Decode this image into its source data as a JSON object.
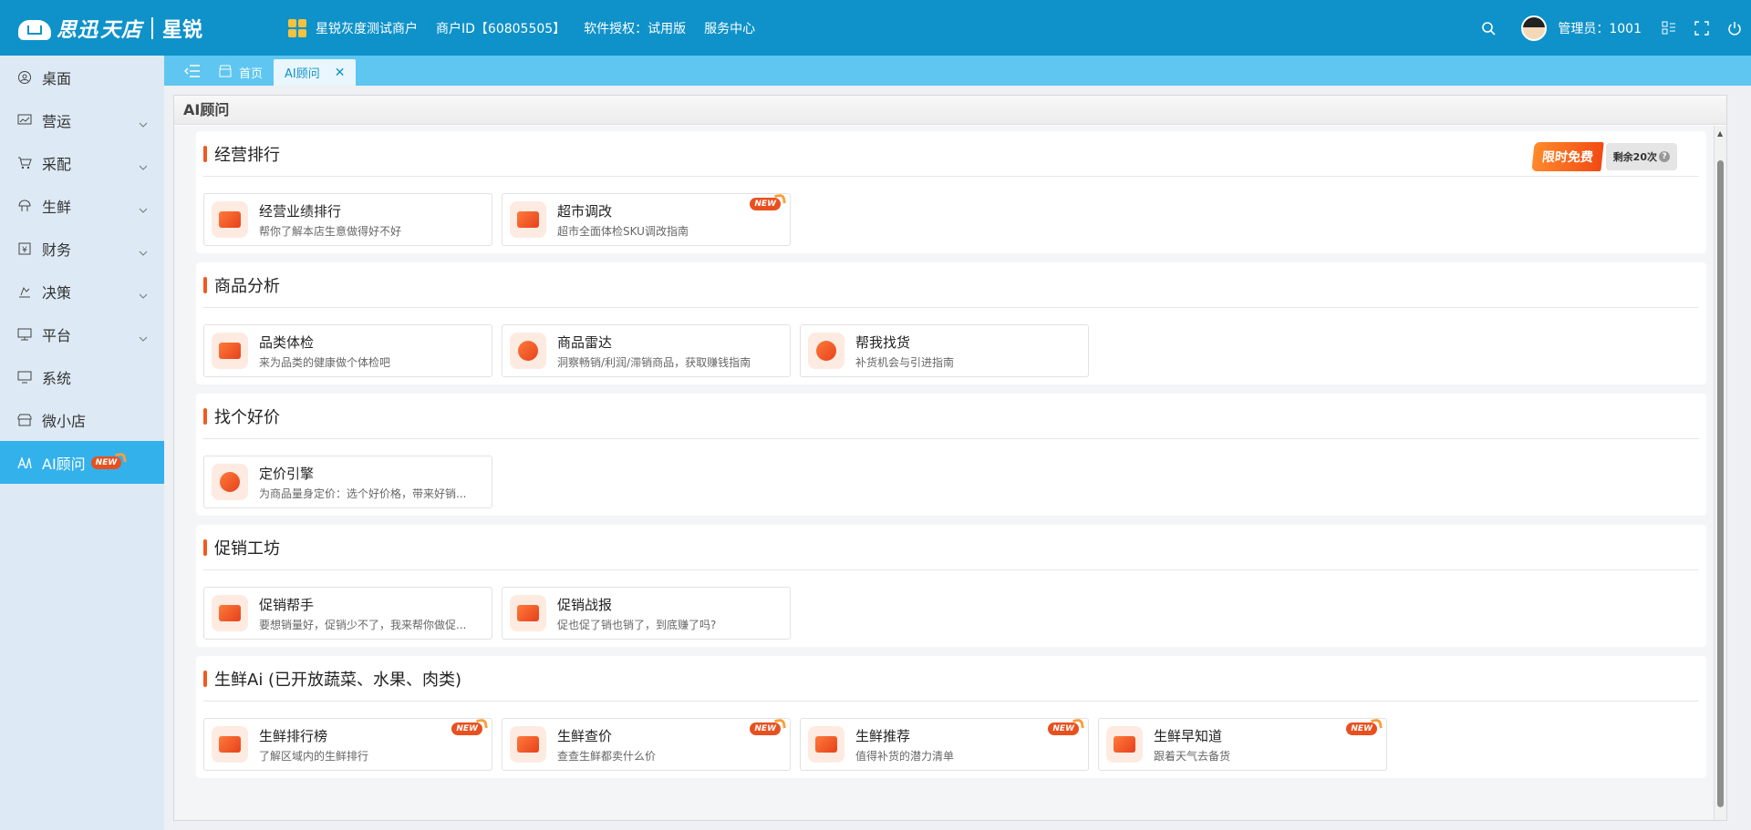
{
  "header": {
    "brand": "思迅",
    "brand2": "天店",
    "product": "星锐",
    "nav": [
      "星锐灰度测试商户",
      "商户ID【60805505】",
      "软件授权：试用版",
      "服务中心"
    ],
    "admin": "管理员：1001"
  },
  "sidebar": {
    "items": [
      {
        "label": "桌面",
        "icon": "desktop-icon",
        "expandable": false
      },
      {
        "label": "营运",
        "icon": "operations-icon",
        "expandable": true
      },
      {
        "label": "采配",
        "icon": "cart-icon",
        "expandable": true
      },
      {
        "label": "生鲜",
        "icon": "fresh-icon",
        "expandable": true
      },
      {
        "label": "财务",
        "icon": "finance-icon",
        "expandable": true
      },
      {
        "label": "决策",
        "icon": "decision-icon",
        "expandable": true
      },
      {
        "label": "平台",
        "icon": "platform-icon",
        "expandable": true
      },
      {
        "label": "系统",
        "icon": "system-icon",
        "expandable": false
      },
      {
        "label": "微小店",
        "icon": "store-icon",
        "expandable": false
      },
      {
        "label": "AI顾问",
        "icon": "ai-icon",
        "expandable": false,
        "active": true,
        "badge": "NEW"
      }
    ]
  },
  "tabs": [
    {
      "label": "首页",
      "active": false
    },
    {
      "label": "AI顾问",
      "active": true
    }
  ],
  "page": {
    "title": "AI顾问",
    "promo_free": "限时免费",
    "promo_remain": "剩余20次",
    "new_badge": "NEW"
  },
  "sections": [
    {
      "title": "经营排行",
      "cards": [
        {
          "title": "经营业绩排行",
          "desc": "帮你了解本店生意做得好不好",
          "new": false
        },
        {
          "title": "超市调改",
          "desc": "超市全面体检SKU调改指南",
          "new": true
        }
      ]
    },
    {
      "title": "商品分析",
      "cards": [
        {
          "title": "品类体检",
          "desc": "来为品类的健康做个体检吧",
          "new": false
        },
        {
          "title": "商品雷达",
          "desc": "洞察畅销/利润/滞销商品，获取赚钱指南",
          "new": false
        },
        {
          "title": "帮我找货",
          "desc": "补货机会与引进指南",
          "new": false
        }
      ]
    },
    {
      "title": "找个好价",
      "cards": [
        {
          "title": "定价引擎",
          "desc": "为商品量身定价：选个好价格，带来好销...",
          "new": false
        }
      ]
    },
    {
      "title": "促销工坊",
      "cards": [
        {
          "title": "促销帮手",
          "desc": "要想销量好，促销少不了，我来帮你做促...",
          "new": false
        },
        {
          "title": "促销战报",
          "desc": "促也促了销也销了，到底赚了吗?",
          "new": false
        }
      ]
    },
    {
      "title": "生鲜Ai (已开放蔬菜、水果、肉类)",
      "cards": [
        {
          "title": "生鲜排行榜",
          "desc": "了解区域内的生鲜排行",
          "new": true
        },
        {
          "title": "生鲜查价",
          "desc": "查查生鲜都卖什么价",
          "new": true
        },
        {
          "title": "生鲜推荐",
          "desc": "值得补货的潜力清单",
          "new": true
        },
        {
          "title": "生鲜早知道",
          "desc": "跟着天气去备货",
          "new": true
        }
      ]
    }
  ],
  "colors": {
    "header_bg": "#0f92c9",
    "tabbar_bg": "#5ec6f0",
    "sidebar_bg": "#ddeaf5",
    "active_item": "#33b1ea",
    "accent": "#f05a1e"
  }
}
